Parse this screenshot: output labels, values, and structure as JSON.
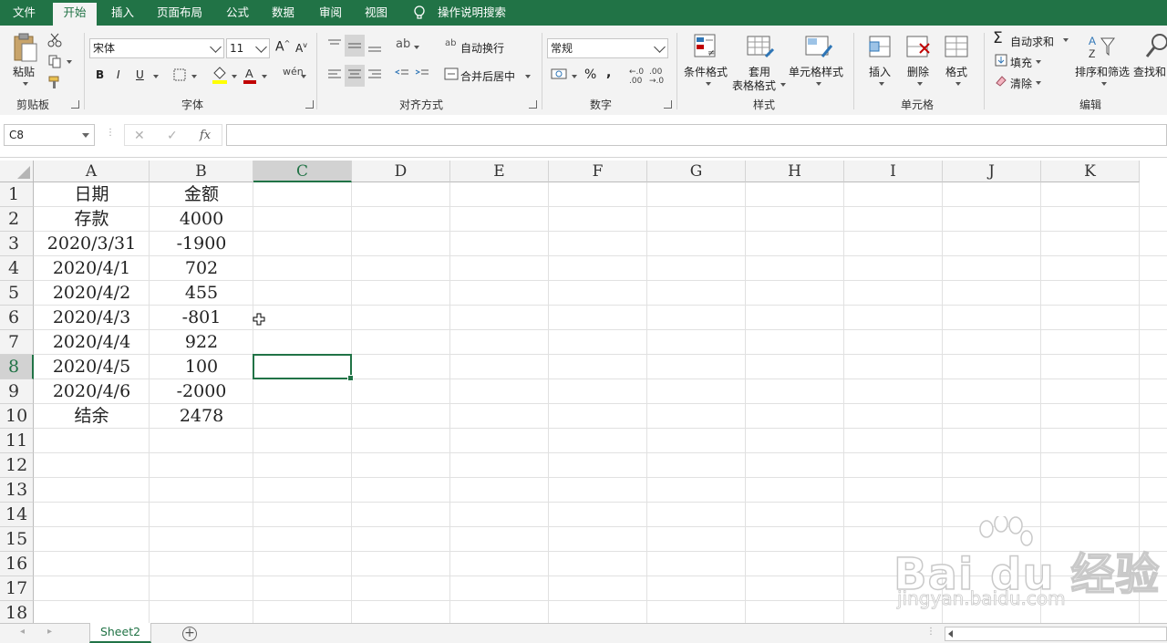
{
  "ribbon_tabs": [
    {
      "label": "文件",
      "active": false
    },
    {
      "label": "开始",
      "active": true
    },
    {
      "label": "插入",
      "active": false
    },
    {
      "label": "页面布局",
      "active": false
    },
    {
      "label": "公式",
      "active": false
    },
    {
      "label": "数据",
      "active": false
    },
    {
      "label": "审阅",
      "active": false
    },
    {
      "label": "视图",
      "active": false
    }
  ],
  "tell_me": "操作说明搜索",
  "clipboard": {
    "paste": "粘贴",
    "group": "剪贴板"
  },
  "font": {
    "name": "宋体",
    "size": "11",
    "bold": "B",
    "italic": "I",
    "underline": "U",
    "group": "字体"
  },
  "alignment": {
    "wrap": "自动换行",
    "merge": "合并后居中",
    "group": "对齐方式"
  },
  "number": {
    "format": "常规",
    "percent": "%",
    "comma": ",",
    "group": "数字"
  },
  "styles": {
    "conditional": "条件格式",
    "table_1": "套用",
    "table_2": "表格格式",
    "cell_styles": "单元格样式",
    "group": "样式"
  },
  "cells": {
    "insert": "插入",
    "delete": "删除",
    "format": "格式",
    "group": "单元格"
  },
  "editing": {
    "autosum": "自动求和",
    "fill": "填充",
    "clear": "清除",
    "sort": "排序和筛选",
    "find": "查找和",
    "group": "编辑"
  },
  "formula_bar": {
    "name_box": "C8",
    "cancel": "✕",
    "enter": "✓",
    "fx": "fx",
    "content": ""
  },
  "columns": [
    "A",
    "B",
    "C",
    "D",
    "E",
    "F",
    "G",
    "H",
    "I",
    "J",
    "K"
  ],
  "selected_column": "C",
  "rows": [
    "1",
    "2",
    "3",
    "4",
    "5",
    "6",
    "7",
    "8",
    "9",
    "10",
    "11",
    "12",
    "13",
    "14",
    "15",
    "16",
    "17",
    "18"
  ],
  "selected_row": "8",
  "table": [
    [
      "日期",
      "金额"
    ],
    [
      "存款",
      "4000"
    ],
    [
      "2020/3/31",
      "-1900"
    ],
    [
      "2020/4/1",
      "702"
    ],
    [
      "2020/4/2",
      "455"
    ],
    [
      "2020/4/3",
      "-801"
    ],
    [
      "2020/4/4",
      "922"
    ],
    [
      "2020/4/5",
      "100"
    ],
    [
      "2020/4/6",
      "-2000"
    ],
    [
      "结余",
      "2478"
    ]
  ],
  "sheets": [
    {
      "name": "Sheet2",
      "active": true
    }
  ],
  "watermark": {
    "brand": "Bai du 经验",
    "url": "jingyan.baidu.com"
  },
  "colors": {
    "brand_green": "#217346",
    "ribbon_bg": "#f3f3f3",
    "grid_line": "#e1e1e1"
  }
}
